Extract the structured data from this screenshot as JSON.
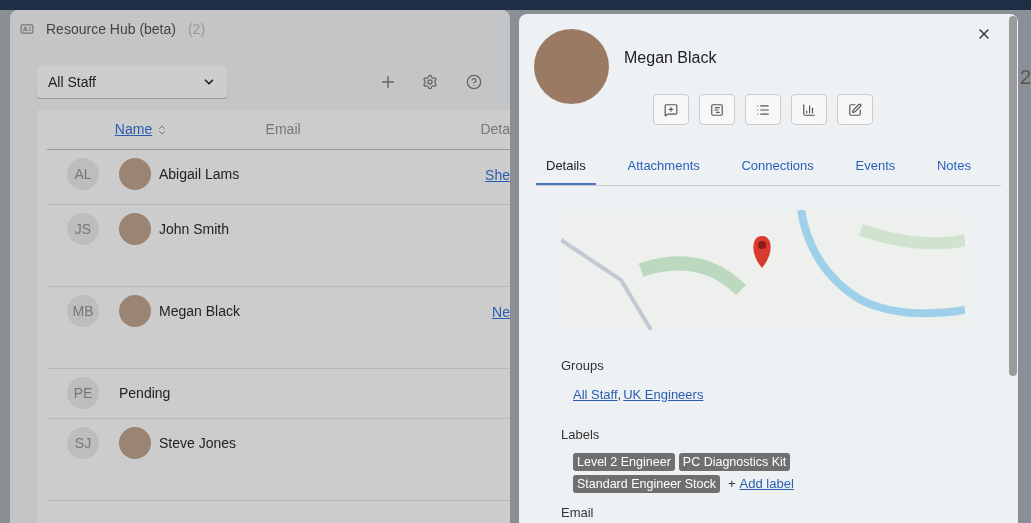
{
  "window": {
    "title": "Resource Hub (beta)",
    "count": "(2)"
  },
  "toolbar": {
    "filter": {
      "value": "All Staff"
    }
  },
  "table": {
    "columns": [
      {
        "label": "Name",
        "kind": "sortable"
      },
      {
        "label": "Email",
        "kind": "plain"
      },
      {
        "label": "Deta",
        "kind": "plain"
      }
    ],
    "rows": [
      {
        "initials": "AL",
        "name": "Abigail Lams",
        "photo": true,
        "detail": "She"
      },
      {
        "initials": "JS",
        "name": "John Smith",
        "photo": true,
        "detail": ""
      },
      {
        "initials": "MB",
        "name": "Megan Black",
        "photo": true,
        "detail": "Ne"
      },
      {
        "initials": "PE",
        "name": "Pending",
        "photo": false,
        "detail": ""
      },
      {
        "initials": "SJ",
        "name": "Steve Jones",
        "photo": true,
        "detail": ""
      }
    ]
  },
  "detail_panel": {
    "name": "Megan Black",
    "actions": [
      {
        "kind": "comment"
      },
      {
        "kind": "form"
      },
      {
        "kind": "list"
      },
      {
        "kind": "chart"
      },
      {
        "kind": "edit"
      }
    ],
    "tabs": [
      {
        "label": "Details",
        "selected": true
      },
      {
        "label": "Attachments",
        "selected": false
      },
      {
        "label": "Connections",
        "selected": false
      },
      {
        "label": "Events",
        "selected": false
      },
      {
        "label": "Notes",
        "selected": false
      }
    ],
    "groups": {
      "label": "Groups",
      "items": [
        "All Staff",
        "UK Engineers"
      ],
      "separator": ","
    },
    "labels": {
      "label": "Labels",
      "items": [
        "Level 2 Engineer",
        "PC Diagnostics Kit",
        "Standard Engineer Stock"
      ],
      "add_prefix": "+",
      "add_link": "Add label"
    },
    "email": {
      "label": "Email"
    }
  },
  "background": {
    "edge_text": "2"
  }
}
